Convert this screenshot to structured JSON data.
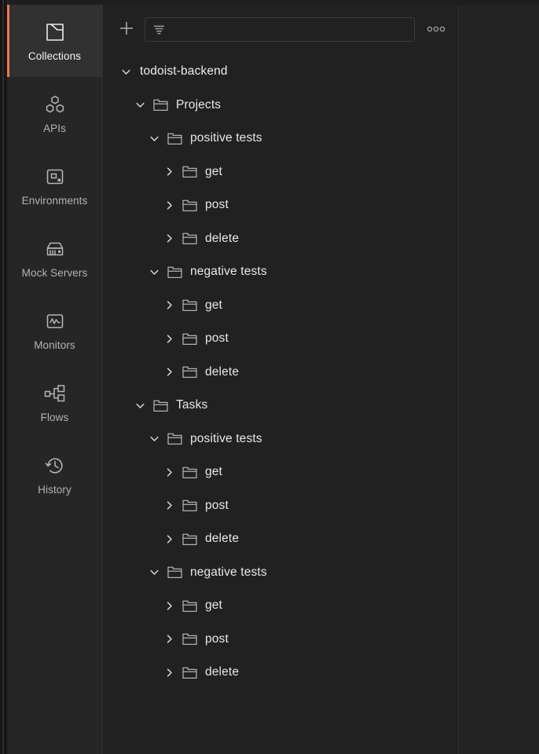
{
  "app": {
    "accent_color": "#f07845",
    "panel_bg": "#212121",
    "sidebar_bg": "#262626"
  },
  "sidebar": {
    "items": [
      {
        "label": "Collections",
        "icon": "collections-icon",
        "active": true
      },
      {
        "label": "APIs",
        "icon": "apis-icon",
        "active": false
      },
      {
        "label": "Environments",
        "icon": "environments-icon",
        "active": false
      },
      {
        "label": "Mock Servers",
        "icon": "mock-servers-icon",
        "active": false
      },
      {
        "label": "Monitors",
        "icon": "monitors-icon",
        "active": false
      },
      {
        "label": "Flows",
        "icon": "flows-icon",
        "active": false
      },
      {
        "label": "History",
        "icon": "history-icon",
        "active": false
      }
    ]
  },
  "toolbar": {
    "new_label": "+",
    "new_icon": "plus-icon",
    "filter_icon": "filter-icon",
    "search_value": "",
    "search_placeholder": "",
    "more_icon": "more-horizontal-icon"
  },
  "tree": {
    "rows": [
      {
        "label": "todoist-backend",
        "depth": 0,
        "expanded": true,
        "chevron": "chevron-down-icon",
        "has_folder_icon": false
      },
      {
        "label": "Projects",
        "depth": 1,
        "expanded": true,
        "chevron": "chevron-down-icon",
        "has_folder_icon": true
      },
      {
        "label": "positive tests",
        "depth": 2,
        "expanded": true,
        "chevron": "chevron-down-icon",
        "has_folder_icon": true
      },
      {
        "label": "get",
        "depth": 3,
        "expanded": false,
        "chevron": "chevron-right-icon",
        "has_folder_icon": true
      },
      {
        "label": "post",
        "depth": 3,
        "expanded": false,
        "chevron": "chevron-right-icon",
        "has_folder_icon": true
      },
      {
        "label": "delete",
        "depth": 3,
        "expanded": false,
        "chevron": "chevron-right-icon",
        "has_folder_icon": true
      },
      {
        "label": "negative tests",
        "depth": 2,
        "expanded": true,
        "chevron": "chevron-down-icon",
        "has_folder_icon": true
      },
      {
        "label": "get",
        "depth": 3,
        "expanded": false,
        "chevron": "chevron-right-icon",
        "has_folder_icon": true
      },
      {
        "label": "post",
        "depth": 3,
        "expanded": false,
        "chevron": "chevron-right-icon",
        "has_folder_icon": true
      },
      {
        "label": "delete",
        "depth": 3,
        "expanded": false,
        "chevron": "chevron-right-icon",
        "has_folder_icon": true
      },
      {
        "label": "Tasks",
        "depth": 1,
        "expanded": true,
        "chevron": "chevron-down-icon",
        "has_folder_icon": true
      },
      {
        "label": "positive tests",
        "depth": 2,
        "expanded": true,
        "chevron": "chevron-down-icon",
        "has_folder_icon": true
      },
      {
        "label": "get",
        "depth": 3,
        "expanded": false,
        "chevron": "chevron-right-icon",
        "has_folder_icon": true
      },
      {
        "label": "post",
        "depth": 3,
        "expanded": false,
        "chevron": "chevron-right-icon",
        "has_folder_icon": true
      },
      {
        "label": "delete",
        "depth": 3,
        "expanded": false,
        "chevron": "chevron-right-icon",
        "has_folder_icon": true
      },
      {
        "label": "negative tests",
        "depth": 2,
        "expanded": true,
        "chevron": "chevron-down-icon",
        "has_folder_icon": true
      },
      {
        "label": "get",
        "depth": 3,
        "expanded": false,
        "chevron": "chevron-right-icon",
        "has_folder_icon": true
      },
      {
        "label": "post",
        "depth": 3,
        "expanded": false,
        "chevron": "chevron-right-icon",
        "has_folder_icon": true
      },
      {
        "label": "delete",
        "depth": 3,
        "expanded": false,
        "chevron": "chevron-right-icon",
        "has_folder_icon": true
      }
    ]
  }
}
